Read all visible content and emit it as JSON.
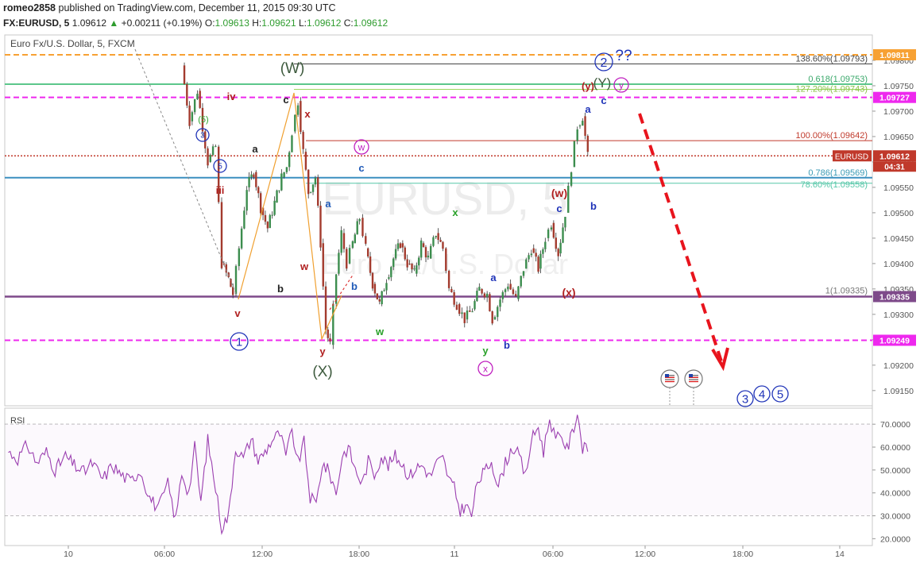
{
  "header": {
    "author": "romeo2858",
    "published_text": "published on TradingView.com, December 11, 2015 09:30 UTC",
    "symbol": "FX:EURUSD, 5",
    "price": "1.09612",
    "change": "+0.00211 (+0.19%)",
    "o_label": "O:",
    "o_value": "1.09613",
    "h_label": "H:",
    "h_value": "1.09621",
    "l_label": "L:",
    "l_value": "1.09612",
    "c_label": "C:",
    "c_value": "1.09612"
  },
  "pane_title": "Euro Fx/U.S. Dollar, 5, FXCM",
  "rsi_label": "RSI",
  "colors": {
    "bull_candle": "#3c8d4e",
    "bear_candle": "#a33b2e",
    "orange_line": "#f7a133",
    "green_line": "#5cc78b",
    "magenta_line": "#ee28ee",
    "red_dotted": "#c0392b",
    "blue_line": "#3a8fc0",
    "purple_line": "#7e4a8a",
    "rsi_line": "#9b3fb0",
    "wave_blue": "#1f33b8",
    "wave_red": "#b01f1f",
    "wave_green": "#2aa12a",
    "wave_black": "#222222",
    "wave_magenta": "#c021c0"
  },
  "chart_data": {
    "type": "line",
    "title": "Euro Fx/U.S. Dollar, 5, FXCM",
    "xlabel": "",
    "ylabel": "",
    "grid": false,
    "ylim": [
      1.0912,
      1.0985
    ],
    "x_ticks": [
      "10",
      "06:00",
      "12:00",
      "18:00",
      "11",
      "06:00",
      "12:00",
      "18:00",
      "14"
    ],
    "y_ticks": [
      "1.09150",
      "1.09200",
      "1.09250",
      "1.09300",
      "1.09350",
      "1.09400",
      "1.09450",
      "1.09500",
      "1.09550",
      "1.09600",
      "1.09650",
      "1.09700",
      "1.09750",
      "1.09800"
    ],
    "price_path": [
      [
        0.204,
        1.0979
      ],
      [
        0.213,
        1.0968
      ],
      [
        0.222,
        1.0974
      ],
      [
        0.234,
        1.096
      ],
      [
        0.243,
        1.0963
      ],
      [
        0.25,
        1.094
      ],
      [
        0.258,
        1.0937
      ],
      [
        0.263,
        1.0934
      ],
      [
        0.27,
        1.0943
      ],
      [
        0.279,
        1.0955
      ],
      [
        0.287,
        1.0958
      ],
      [
        0.295,
        1.0951
      ],
      [
        0.303,
        1.0947
      ],
      [
        0.311,
        1.0952
      ],
      [
        0.319,
        1.0957
      ],
      [
        0.325,
        1.0959
      ],
      [
        0.331,
        1.0966
      ],
      [
        0.338,
        1.0972
      ],
      [
        0.344,
        1.0962
      ],
      [
        0.35,
        1.0954
      ],
      [
        0.358,
        1.0957
      ],
      [
        0.364,
        1.0944
      ],
      [
        0.37,
        1.0927
      ],
      [
        0.375,
        1.0924
      ],
      [
        0.382,
        1.0938
      ],
      [
        0.388,
        1.0946
      ],
      [
        0.394,
        1.094
      ],
      [
        0.401,
        1.0944
      ],
      [
        0.409,
        1.0949
      ],
      [
        0.416,
        1.0943
      ],
      [
        0.424,
        1.0936
      ],
      [
        0.432,
        1.0932
      ],
      [
        0.44,
        1.0937
      ],
      [
        0.448,
        1.0941
      ],
      [
        0.456,
        1.0944
      ],
      [
        0.464,
        1.094
      ],
      [
        0.472,
        1.0938
      ],
      [
        0.48,
        1.0944
      ],
      [
        0.488,
        1.0941
      ],
      [
        0.497,
        1.0946
      ],
      [
        0.505,
        1.0943
      ],
      [
        0.512,
        1.0935
      ],
      [
        0.521,
        1.0932
      ],
      [
        0.53,
        1.0929
      ],
      [
        0.539,
        1.0931
      ],
      [
        0.547,
        1.0935
      ],
      [
        0.556,
        1.0934
      ],
      [
        0.562,
        1.0929
      ],
      [
        0.571,
        1.0933
      ],
      [
        0.58,
        1.0936
      ],
      [
        0.589,
        1.0933
      ],
      [
        0.598,
        1.0939
      ],
      [
        0.607,
        1.0943
      ],
      [
        0.615,
        1.0939
      ],
      [
        0.623,
        1.0945
      ],
      [
        0.63,
        1.0948
      ],
      [
        0.638,
        1.0942
      ],
      [
        0.646,
        1.095
      ],
      [
        0.653,
        1.0959
      ],
      [
        0.66,
        1.0967
      ],
      [
        0.666,
        1.0969
      ],
      [
        0.672,
        1.0961
      ]
    ],
    "rsi": {
      "ylim": [
        17,
        77
      ],
      "y_ticks": [
        "20.0000",
        "30.0000",
        "40.0000",
        "50.0000",
        "60.0000",
        "70.0000"
      ],
      "path": [
        [
          0.004,
          58
        ],
        [
          0.015,
          55
        ],
        [
          0.026,
          61
        ],
        [
          0.037,
          53
        ],
        [
          0.048,
          58
        ],
        [
          0.058,
          50
        ],
        [
          0.07,
          56
        ],
        [
          0.08,
          52
        ],
        [
          0.091,
          49
        ],
        [
          0.101,
          53
        ],
        [
          0.113,
          46
        ],
        [
          0.124,
          52
        ],
        [
          0.134,
          48
        ],
        [
          0.145,
          45
        ],
        [
          0.156,
          50
        ],
        [
          0.167,
          38
        ],
        [
          0.177,
          33
        ],
        [
          0.188,
          44
        ],
        [
          0.197,
          28
        ],
        [
          0.204,
          49
        ],
        [
          0.212,
          40
        ],
        [
          0.219,
          60
        ],
        [
          0.226,
          36
        ],
        [
          0.234,
          63
        ],
        [
          0.243,
          42
        ],
        [
          0.25,
          25
        ],
        [
          0.258,
          30
        ],
        [
          0.266,
          60
        ],
        [
          0.275,
          55
        ],
        [
          0.284,
          64
        ],
        [
          0.292,
          54
        ],
        [
          0.3,
          58
        ],
        [
          0.308,
          63
        ],
        [
          0.317,
          66
        ],
        [
          0.324,
          56
        ],
        [
          0.331,
          67
        ],
        [
          0.338,
          53
        ],
        [
          0.345,
          62
        ],
        [
          0.352,
          38
        ],
        [
          0.359,
          35
        ],
        [
          0.366,
          53
        ],
        [
          0.374,
          49
        ],
        [
          0.382,
          40
        ],
        [
          0.389,
          56
        ],
        [
          0.396,
          60
        ],
        [
          0.404,
          50
        ],
        [
          0.412,
          44
        ],
        [
          0.419,
          54
        ],
        [
          0.426,
          48
        ],
        [
          0.434,
          56
        ],
        [
          0.442,
          52
        ],
        [
          0.45,
          56
        ],
        [
          0.458,
          53
        ],
        [
          0.466,
          47
        ],
        [
          0.474,
          51
        ],
        [
          0.482,
          52
        ],
        [
          0.49,
          47
        ],
        [
          0.498,
          53
        ],
        [
          0.505,
          55
        ],
        [
          0.512,
          46
        ],
        [
          0.518,
          42
        ],
        [
          0.525,
          32
        ],
        [
          0.531,
          35
        ],
        [
          0.538,
          30
        ],
        [
          0.545,
          45
        ],
        [
          0.553,
          49
        ],
        [
          0.561,
          54
        ],
        [
          0.569,
          43
        ],
        [
          0.577,
          53
        ],
        [
          0.585,
          60
        ],
        [
          0.593,
          56
        ],
        [
          0.6,
          47
        ],
        [
          0.607,
          63
        ],
        [
          0.615,
          69
        ],
        [
          0.621,
          58
        ],
        [
          0.628,
          73
        ],
        [
          0.635,
          63
        ],
        [
          0.642,
          65
        ],
        [
          0.648,
          59
        ],
        [
          0.654,
          66
        ],
        [
          0.66,
          75
        ],
        [
          0.666,
          60
        ],
        [
          0.672,
          58
        ]
      ]
    }
  },
  "price_levels": [
    {
      "id": "orange",
      "value": "1.09811",
      "label": "",
      "style": "dashed",
      "color": "#f7a133"
    },
    {
      "id": "fib1386",
      "value": "",
      "label": "138.60%(1.09793)",
      "style": "solid",
      "color": "#444444"
    },
    {
      "id": "green",
      "value": "",
      "label": "0.618(1.09753)",
      "label2": "127.20%(1.09743)",
      "style": "solid",
      "color": "#5cc78b"
    },
    {
      "id": "mag_top",
      "value": "1.09727",
      "label": "",
      "style": "dashed",
      "color": "#ee28ee"
    },
    {
      "id": "fib100",
      "value": "",
      "label": "100.00%(1.09642)",
      "style": "solid",
      "color": "#c0392b"
    },
    {
      "id": "current",
      "value": "1.09612",
      "label": "EURUSD",
      "countdown": "04:31",
      "style": "dotted",
      "color": "#c0392b"
    },
    {
      "id": "blue",
      "value": "",
      "label": "0.786(1.09569)",
      "label2": "78.60%(1.09558)",
      "style": "solid",
      "color": "#3a8fc0"
    },
    {
      "id": "purple",
      "value": "1.09335",
      "label": "1(1.09335)",
      "style": "solid",
      "color": "#7e4a8a"
    },
    {
      "id": "mag_bot",
      "value": "1.09249",
      "label": "",
      "style": "dashed",
      "color": "#ee28ee"
    }
  ],
  "wave_labels": {
    "W_big": "(W)",
    "X_big": "(X)",
    "Y_big": "(Y)",
    "two": "2",
    "qq": "??",
    "one": "1",
    "three": "3",
    "four": "4",
    "five": "5",
    "three_small": "3",
    "five_small": "5",
    "five_paren": "(5)",
    "iv": "iv",
    "iii": "iii",
    "v": "v",
    "a": "a",
    "b": "b",
    "c": "c",
    "w": "w",
    "x": "x",
    "y": "y",
    "w_paren": "(w)",
    "x_paren": "(x)",
    "y_paren": "(y)"
  },
  "watermark": "EURUSD, 5",
  "watermark_sub": "Euro Fx/U.S. Dollar"
}
